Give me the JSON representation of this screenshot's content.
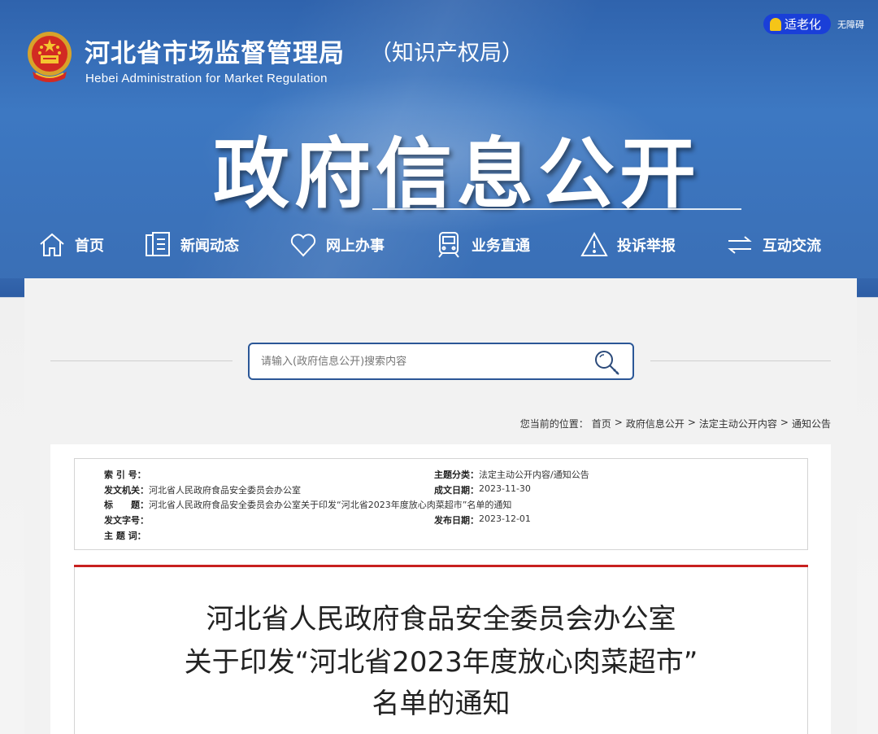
{
  "header": {
    "site_name": "河北省市场监督管理局",
    "site_name_sub": "（知识产权局）",
    "site_name_en": "Hebei Administration for Market Regulation",
    "elder_mode_label": "适老化",
    "barrier_free_label": "无障碍",
    "section_title": "政府信息公开"
  },
  "nav": {
    "items": [
      {
        "label": "首页",
        "icon": "home-icon"
      },
      {
        "label": "新闻动态",
        "icon": "news-icon"
      },
      {
        "label": "网上办事",
        "icon": "heart-icon"
      },
      {
        "label": "业务直通",
        "icon": "train-icon"
      },
      {
        "label": "投诉举报",
        "icon": "warning-icon"
      },
      {
        "label": "互动交流",
        "icon": "exchange-icon"
      }
    ]
  },
  "search": {
    "placeholder": "请输入(政府信息公开)搜索内容"
  },
  "breadcrumb": {
    "prefix": "您当前的位置：",
    "items": [
      "首页",
      "政府信息公开",
      "法定主动公开内容",
      "通知公告"
    ],
    "separator": ">"
  },
  "meta": {
    "index_no_label": "索 引 号：",
    "index_no_value": "",
    "issuer_label": "发文机关：",
    "issuer_value": "河北省人民政府食品安全委员会办公室",
    "title_label": "标　　题：",
    "title_value": "河北省人民政府食品安全委员会办公室关于印发“河北省2023年度放心肉菜超市”名单的通知",
    "doc_no_label": "发文字号：",
    "doc_no_value": "",
    "keywords_label": "主 题 词：",
    "keywords_value": "",
    "category_label": "主题分类：",
    "category_value": "法定主动公开内容/通知公告",
    "created_label": "成文日期：",
    "created_value": "2023-11-30",
    "published_label": "发布日期：",
    "published_value": "2023-12-01"
  },
  "article": {
    "title_line1": "河北省人民政府食品安全委员会办公室",
    "title_line2": "关于印发“河北省2023年度放心肉菜超市”",
    "title_line3": "名单的通知"
  },
  "colors": {
    "banner_blue": "#3a72bb",
    "nav_text": "#ffffff",
    "elder_btn": "#1a3fd8",
    "search_border": "#2b5797",
    "red_rule": "#c8201f"
  }
}
